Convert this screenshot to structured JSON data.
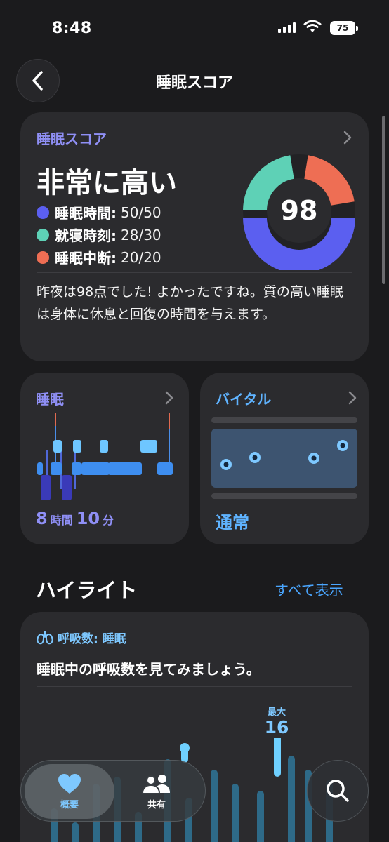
{
  "status_bar": {
    "time": "8:48",
    "battery": "75"
  },
  "header": {
    "title": "睡眠スコア"
  },
  "score_card": {
    "label": "睡眠スコア",
    "headline": "非常に高い",
    "score": "98",
    "metrics": [
      {
        "name": "睡眠時間:",
        "value": "50/50",
        "color": "#5b5ff0"
      },
      {
        "name": "就寝時刻:",
        "value": "28/30",
        "color": "#5ed1b6"
      },
      {
        "name": "睡眠中断:",
        "value": "20/20",
        "color": "#ee6e54"
      }
    ],
    "description": "昨夜は98点でした! よかったですね。質の高い睡眠は身体に休息と回復の時間を与えます。"
  },
  "sleep_card": {
    "title": "睡眠",
    "hours": "8",
    "hours_unit": "時間",
    "minutes": "10",
    "minutes_unit": "分"
  },
  "vital_card": {
    "title": "バイタル",
    "status": "通常"
  },
  "highlights": {
    "title": "ハイライト",
    "show_all": "すべて表示",
    "card": {
      "tag": "呼吸数: 睡眠",
      "text": "睡眠中の呼吸数を見てみましょう。",
      "max_label": "最大",
      "max_value": "16"
    }
  },
  "tabbar": {
    "tabs": [
      {
        "label": "概要"
      },
      {
        "label": "共有"
      }
    ]
  },
  "colors": {
    "accent_purple": "#8f8ff5",
    "accent_blue": "#4aa6ff",
    "card_bg": "#2b2b2e"
  }
}
